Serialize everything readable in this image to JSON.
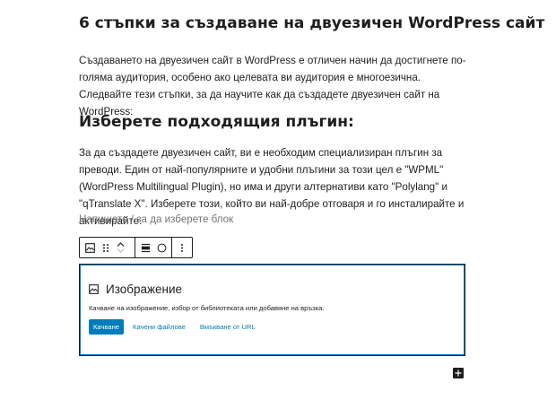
{
  "post": {
    "title": "6 стъпки за създаване на двуезичен WordPress сайт",
    "intro": "Създаването на двуезичен сайт в WordPress е отличен начин да достигнете по-голяма аудитория, особено ако целевата ви аудитория е многоезична. Следвайте тези стъпки, за да научите как да създадете двуезичен сайт на WordPress:",
    "section_heading": "Изберете подходящия плъгин:",
    "section_text": "За да създадете двуезичен сайт, ви е необходим специализиран плъгин за преводи. Един от най-популярните и удобни плъгини за този цел е \"WPML\" (WordPress Multilingual Plugin), но има и други алтернативи като \"Polylang\" и \"qTranslate X\". Изберете този, който ви най-добре отговаря и го инсталирайте и активирайте."
  },
  "editor": {
    "empty_block_placeholder": "Напишете / за да изберете блок",
    "toolbar": {
      "icons": [
        "image-icon",
        "drag-handle-icon",
        "move-up-icon",
        "move-down-icon",
        "align-icon",
        "circle-crop-icon",
        "more-options-icon"
      ]
    },
    "image_block": {
      "title": "Изображение",
      "description": "Качване на изображение, избор от библиотеката или добавяне на връзка.",
      "upload_label": "Качване",
      "media_library_label": "Качени файлове",
      "insert_url_label": "Вмъкване от URL"
    },
    "inserter_icon": "plus-icon"
  },
  "colors": {
    "accent": "#007cba",
    "text": "#1e1e1e",
    "muted": "#757575"
  }
}
